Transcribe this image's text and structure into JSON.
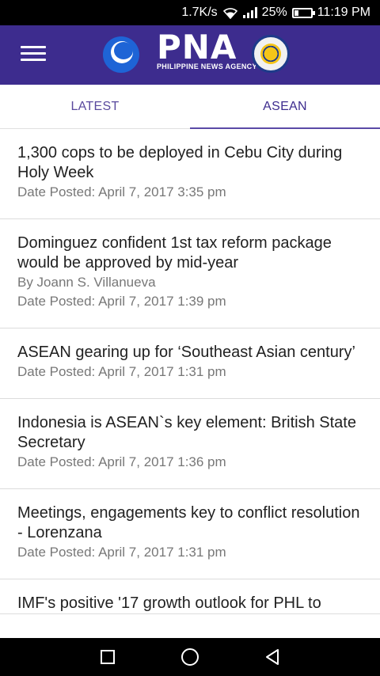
{
  "status_bar": {
    "speed": "1.7K/s",
    "battery_text": "25%",
    "battery_level": 0.25,
    "time": "11:19 PM"
  },
  "app_bar": {
    "logo_title": "PNA",
    "logo_subtitle": "PHILIPPINE NEWS AGENCY"
  },
  "tabs": [
    {
      "label": "LATEST",
      "active": false
    },
    {
      "label": "ASEAN",
      "active": true
    }
  ],
  "news": [
    {
      "title": "1,300 cops to be deployed in Cebu City during Holy Week",
      "author": "",
      "date": "Date Posted: April 7, 2017 3:35 pm"
    },
    {
      "title": "Dominguez confident 1st tax reform package would be approved by mid-year",
      "author": "By Joann S. Villanueva",
      "date": "Date Posted: April 7, 2017 1:39 pm"
    },
    {
      "title": "ASEAN gearing up for ‘Southeast Asian century’",
      "author": "",
      "date": "Date Posted: April 7, 2017 1:31 pm"
    },
    {
      "title": "Indonesia is ASEAN`s key element: British State Secretary",
      "author": "",
      "date": "Date Posted: April 7, 2017 1:36 pm"
    },
    {
      "title": "Meetings, engagements key to conflict resolution - Lorenzana",
      "author": "",
      "date": "Date Posted: April 7, 2017 1:31 pm"
    },
    {
      "title": "IMF's positive '17 growth outlook for PHL to",
      "author": "",
      "date": ""
    }
  ],
  "icons": {
    "wifi": "wifi-icon",
    "signal": "signal-icon",
    "battery": "battery-icon",
    "menu": "menu-icon",
    "back": "back-icon",
    "home": "home-icon",
    "recents": "recents-icon"
  }
}
